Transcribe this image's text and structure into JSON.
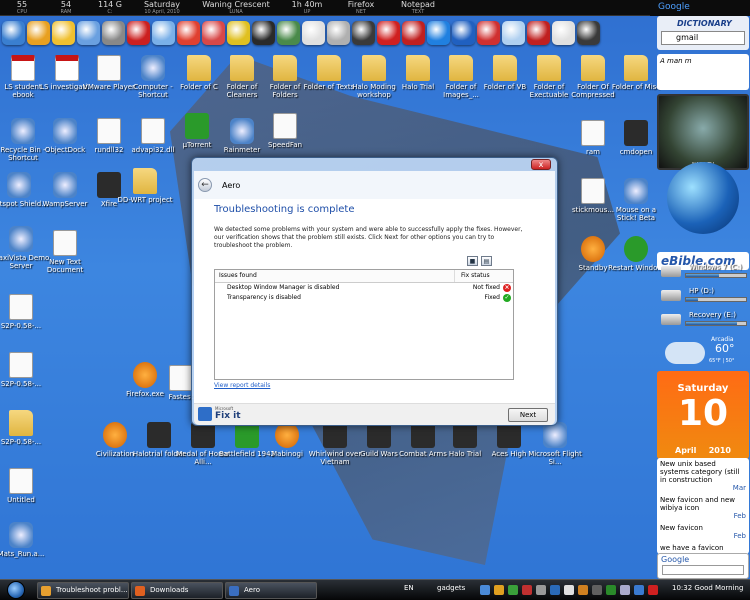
{
  "stats": [
    {
      "value": "55",
      "label": "CPU"
    },
    {
      "value": "54",
      "label": "RAM"
    },
    {
      "value": "114 G",
      "label": "C:"
    },
    {
      "value": "Saturday",
      "label": "10 April, 2010"
    },
    {
      "value": "Waning Crescent",
      "label": "LUNA"
    },
    {
      "value": "1h 40m",
      "label": "UP"
    },
    {
      "value": "Firefox",
      "label": "NET"
    },
    {
      "value": "Notepad",
      "label": "TEXT"
    }
  ],
  "google_top": "Google",
  "dock_colors": [
    "#3a7fd0",
    "#e8a020",
    "#f0c030",
    "#6aa0e0",
    "#888",
    "#cc2020",
    "#7ab0e8",
    "#e04030",
    "#d84848",
    "#e0c020",
    "#2a2a2a",
    "#4a8a4a",
    "#e0e0e0",
    "#b0b0b0",
    "#3a3a3a",
    "#d02020",
    "#c02020",
    "#2080e0",
    "#2060c0",
    "#d03030",
    "#b0d0f0",
    "#c02020",
    "#e0e0e0",
    "#3a3a3a"
  ],
  "desktop_icons": {
    "ls_student": "LS student ebook",
    "ls_invest": "LS investigati...",
    "vmware": "VMware Player",
    "computer": "Computer - Shortcut",
    "folder_c": "Folder of C",
    "folder_cleaners": "Folder of Cleaners",
    "folder_folders": "Folder of Folders",
    "folder_texts": "Folder of Texts",
    "halo_modding": "Halo Moding workshop",
    "halo_trial_top": "Halo Trial",
    "folder_images": "Folder of Images_...",
    "folder_vb": "Folder of VB",
    "folder_exec": "Folder of Exectuable",
    "folder_compressed": "Folder Of Compressed",
    "folder_misc": "Folder of Misc",
    "recycle": "Recycle Bin - Shortcut",
    "objectdock": "ObjectDock",
    "rundll": "rundll32",
    "advapi": "advapi32.dll",
    "utorrent": "µTorrent",
    "rainmeter": "Rainmeter",
    "speedfan": "SpeedFan",
    "ram": "ram",
    "cmdopen": "cmdopen",
    "hotspot": "Hotspot Shield...",
    "wampserver": "WampServer",
    "xfire": "Xfire",
    "ddwrt": "DD-WRT project",
    "stickmouse": "stickmous...",
    "mouse_stick": "Mouse on a Stick! Beta",
    "maxvista": "MaxiVista Demo Server",
    "new_text": "New Text Document",
    "standby": "Standby",
    "restart": "Restart Windo...",
    "s2p_1": "S2P-0.58-...",
    "s2p_2": "S2P-0.58-...",
    "s2p_3": "S2P-0.58-...",
    "firefox": "Firefox.exe",
    "fastest": "Fastest",
    "civilization": "Civilization",
    "halotrial_folder": "Halotrial folder",
    "medal": "Medal of Honor Alli...",
    "battlefield": "Battlefield 1942",
    "mabinogi": "Mabinogi",
    "whirlwind": "Whirlwind over Vietnam",
    "guild_wars": "Guild Wars",
    "combat_arms": "Combat Arms",
    "halo_trial": "Halo Trial",
    "aces_high": "Aces High",
    "ms_flight": "Microsoft Flight Si...",
    "untitled": "Untitled",
    "mats_run": "Mats_Run.a..."
  },
  "sidebar": {
    "dictionary_title": "DICTIONARY",
    "dictionary_value": "gmail",
    "comic_text": "A man m",
    "sat_label": "NASA TV",
    "ebible": "eBible.com",
    "drives": [
      {
        "label": "Windows 7 (C:)",
        "fill": 0.55
      },
      {
        "label": "HP (D:)",
        "fill": 0.2
      },
      {
        "label": "Recovery (E:)",
        "fill": 0.85
      }
    ],
    "weather": {
      "city": "Arcadia",
      "temp": "60°",
      "hilo": "65°F | 50°"
    },
    "calendar": {
      "day": "Saturday",
      "date": "10",
      "month": "April",
      "year": "2010"
    },
    "feed": [
      {
        "title": "New unix based systems category (still in construction",
        "date": "Mar"
      },
      {
        "title": "New favicon and new wibiya icon",
        "date": "Feb"
      },
      {
        "title": "New favicon",
        "date": "Feb"
      },
      {
        "title": "we have a favicon",
        "date": ""
      }
    ],
    "google_gadget": "Google"
  },
  "dialog": {
    "title": "Aero",
    "close_label": "x",
    "heading": "Troubleshooting is complete",
    "message": "We detected some problems with your system and were able to successfully apply the fixes. However, our verification shows that the problem still exists. Click Next for other options you can try to troubleshoot the problem.",
    "col_issue": "Issues found",
    "col_status": "Fix status",
    "issues": [
      {
        "name": "Desktop Window Manager is disabled",
        "status": "Not fixed",
        "ok": false
      },
      {
        "name": "Transparency is disabled",
        "status": "Fixed",
        "ok": true
      }
    ],
    "report_link": "View report details",
    "brand": "Fix it",
    "brand_small": "Microsoft",
    "next_label": "Next"
  },
  "taskbar": {
    "tasks": [
      {
        "label": "Troubleshoot probl...",
        "color": "#e8a030"
      },
      {
        "label": "Downloads",
        "color": "#e06020"
      },
      {
        "label": "Aero",
        "color": "#3a6ec0"
      }
    ],
    "lang": "EN",
    "gadgets": "gadgets",
    "clock": "10:32 Good Morning"
  }
}
